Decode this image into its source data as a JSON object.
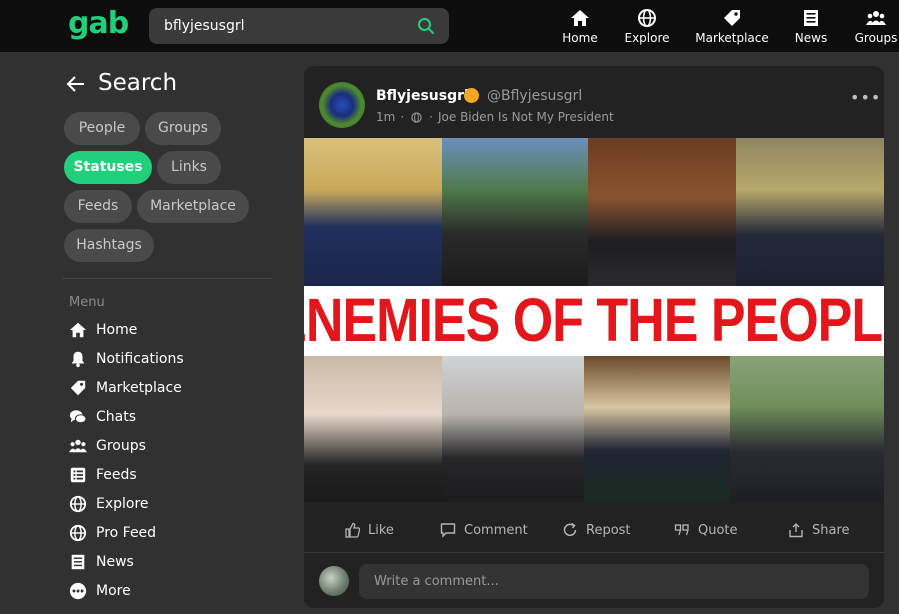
{
  "brand": {
    "logo": "gab",
    "accent": "#21cf7a"
  },
  "search": {
    "value": "bflyjesusgrl",
    "icon": "search-icon"
  },
  "top_nav": [
    {
      "label": "Home",
      "icon": "home-icon"
    },
    {
      "label": "Explore",
      "icon": "globe-icon"
    },
    {
      "label": "Marketplace",
      "icon": "tag-icon"
    },
    {
      "label": "News",
      "icon": "newspaper-icon"
    },
    {
      "label": "Groups",
      "icon": "group-icon"
    }
  ],
  "sidebar": {
    "title": "Search",
    "filters": [
      {
        "label": "People",
        "active": false
      },
      {
        "label": "Groups",
        "active": false
      },
      {
        "label": "Statuses",
        "active": true
      },
      {
        "label": "Links",
        "active": false
      },
      {
        "label": "Feeds",
        "active": false
      },
      {
        "label": "Marketplace",
        "active": false
      },
      {
        "label": "Hashtags",
        "active": false
      }
    ],
    "menu_heading": "Menu",
    "menu": [
      {
        "label": "Home",
        "icon": "home-icon"
      },
      {
        "label": "Notifications",
        "icon": "bell-icon"
      },
      {
        "label": "Marketplace",
        "icon": "tag-icon"
      },
      {
        "label": "Chats",
        "icon": "chat-icon"
      },
      {
        "label": "Groups",
        "icon": "group-icon"
      },
      {
        "label": "Feeds",
        "icon": "list-icon"
      },
      {
        "label": "Explore",
        "icon": "globe-icon"
      },
      {
        "label": "Pro Feed",
        "icon": "globe-icon"
      },
      {
        "label": "News",
        "icon": "newspaper-icon"
      },
      {
        "label": "More",
        "icon": "more-icon"
      }
    ]
  },
  "post": {
    "author": "Bflyjesusgrl",
    "handle": "@Bflyjesusgrl",
    "time": "1m",
    "group": "Joe Biden Is Not My President",
    "image_banner": "ENEMIES OF THE PEOPLE",
    "actions": [
      {
        "label": "Like",
        "icon": "thumbs-up-icon"
      },
      {
        "label": "Comment",
        "icon": "comment-icon"
      },
      {
        "label": "Repost",
        "icon": "repost-icon"
      },
      {
        "label": "Quote",
        "icon": "quote-icon"
      },
      {
        "label": "Share",
        "icon": "share-icon"
      }
    ],
    "comment_placeholder": "Write a comment..."
  }
}
